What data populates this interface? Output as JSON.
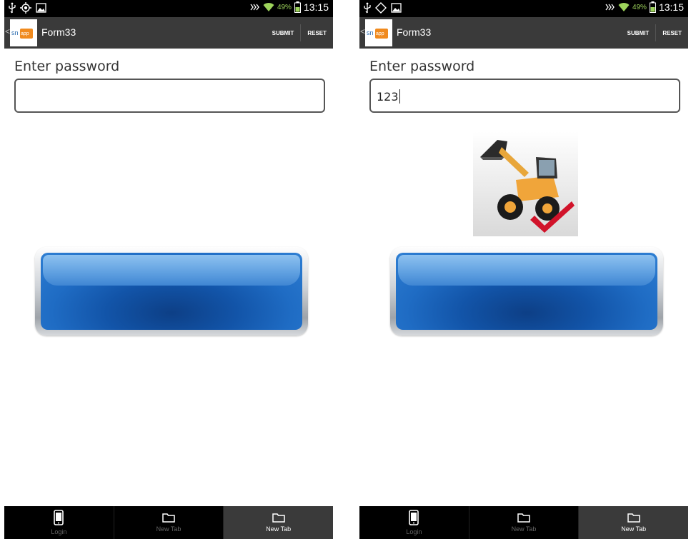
{
  "colors": {
    "status_bar": "#000000",
    "action_bar": "#3a3a3a",
    "tab_bar": "#000000",
    "tab_selected": "#3a3a3a",
    "button_blue": "#1f6cc4",
    "battery_green": "#9dd35b"
  },
  "screens": [
    {
      "status": {
        "icons": [
          "usb-icon",
          "location-icon",
          "image-icon"
        ],
        "right_icons": [
          "nfc-icon",
          "wifi-icon",
          "battery-icon"
        ],
        "battery": "49%",
        "time": "13:15"
      },
      "app": {
        "back": "<",
        "logo_icon": "snappii-logo-icon",
        "title": "Form33",
        "submit_label": "SUBMIT",
        "reset_label": "RESET"
      },
      "form": {
        "password_label": "Enter password",
        "password_value": ""
      },
      "tabs": [
        {
          "label": "Login",
          "icon": "phone-icon",
          "selected": false
        },
        {
          "label": "New Tab",
          "icon": "folder-icon",
          "selected": false
        },
        {
          "label": "New Tab",
          "icon": "folder-icon",
          "selected": true
        }
      ]
    },
    {
      "status": {
        "icons": [
          "usb-icon",
          "location-icon",
          "image-icon"
        ],
        "right_icons": [
          "nfc-icon",
          "wifi-icon",
          "battery-icon"
        ],
        "battery": "49%",
        "time": "13:15"
      },
      "app": {
        "back": "<",
        "logo_icon": "snappii-logo-icon",
        "title": "Form33",
        "submit_label": "SUBMIT",
        "reset_label": "RESET"
      },
      "form": {
        "password_label": "Enter password",
        "password_value": "123",
        "image_icon": "wheel-loader-checkmark-icon"
      },
      "tabs": [
        {
          "label": "Login",
          "icon": "phone-icon",
          "selected": false
        },
        {
          "label": "New Tab",
          "icon": "folder-icon",
          "selected": false
        },
        {
          "label": "New Tab",
          "icon": "folder-icon",
          "selected": true
        }
      ]
    }
  ]
}
